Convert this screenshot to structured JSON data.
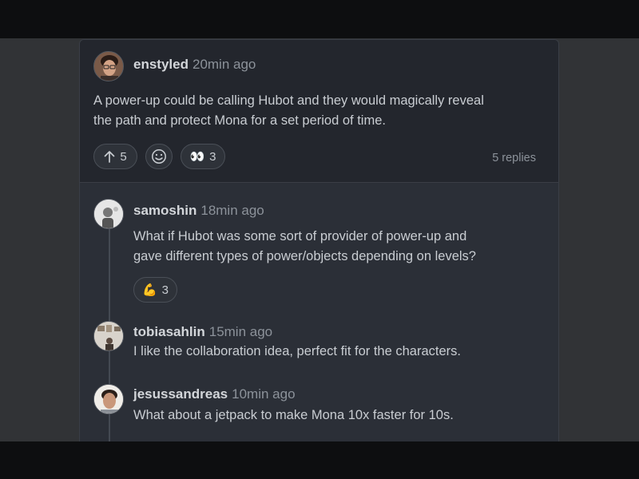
{
  "post": {
    "user": "enstyled",
    "time": "20min ago",
    "text_line1": "A power-up could be calling Hubot and they would magically reveal",
    "text_line2": "the path and protect Mona for a set period of time.",
    "upvote_count": "5",
    "eyes_emoji": "👀",
    "eyes_count": "3",
    "replies_label": "5 replies"
  },
  "replies": [
    {
      "user": "samoshin",
      "time": "18min ago",
      "text_line1": "What if Hubot was some sort of provider of power-up and",
      "text_line2": "gave different types of power/objects depending on levels?",
      "reaction_emoji": "💪",
      "reaction_count": "3"
    },
    {
      "user": "tobiasahlin",
      "time": "15min ago",
      "text_line1": "I like the collaboration idea, perfect fit for the characters."
    },
    {
      "user": "jesussandreas",
      "time": "10min ago",
      "text_line1": "What about a jetpack to make Mona 10x faster for 10s."
    }
  ]
}
